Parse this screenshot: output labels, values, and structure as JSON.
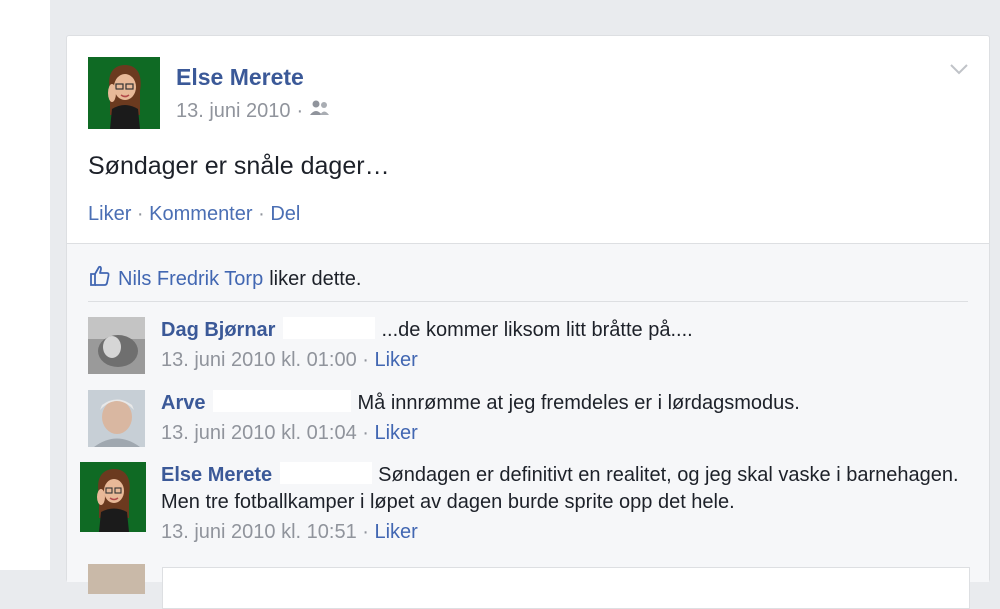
{
  "post": {
    "author": "Else Merete",
    "date": "13. juni 2010",
    "meta_sep": "·",
    "text": "Søndager er snåle dager…",
    "actions": {
      "like": "Liker",
      "comment": "Kommenter",
      "share": "Del",
      "sep": "·"
    }
  },
  "likes": {
    "name": "Nils Fredrik Torp",
    "suffix": "liker dette."
  },
  "comments": [
    {
      "name": "Dag Bjørnar",
      "text": "...de kommer liksom litt bråtte på....",
      "time": "13. juni 2010 kl. 01:00",
      "like": "Liker"
    },
    {
      "name": "Arve",
      "text": "Må innrømme at jeg fremdeles er i lørdagsmodus.",
      "time": "13. juni 2010 kl. 01:04",
      "like": "Liker"
    },
    {
      "name": "Else Merete",
      "text": "Søndagen er definitivt en realitet, og jeg skal vaske i barnehagen. Men tre fotballkamper i løpet av dagen burde sprite opp det hele.",
      "time": "13. juni 2010 kl. 10:51",
      "like": "Liker"
    }
  ],
  "meta_sep": " · ",
  "colors": {
    "link": "#3b5998",
    "meta": "#90949c",
    "avatar_bg": "#0f6a24"
  },
  "icons": {
    "audience": "friends-icon",
    "options": "chevron-down-icon",
    "like": "thumbs-up-icon"
  }
}
